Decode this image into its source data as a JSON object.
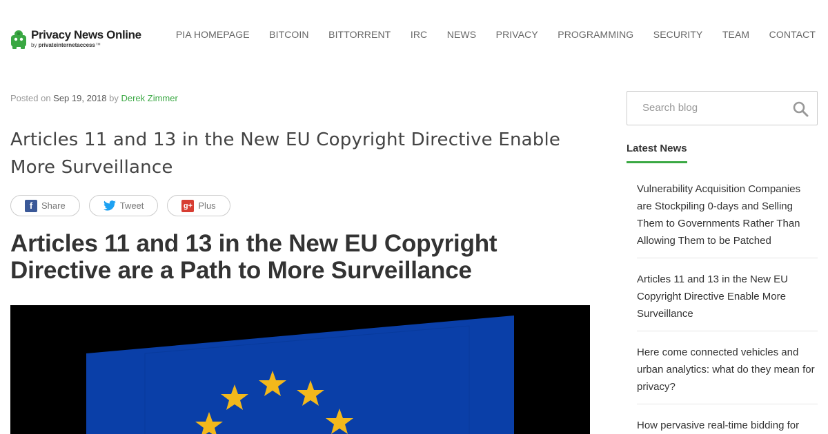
{
  "header": {
    "logo_title": "Privacy News Online",
    "logo_sub_prefix": "by ",
    "logo_sub_brand": "privateinternetaccess",
    "logo_sub_tm": "™",
    "nav": [
      "PIA HOMEPAGE",
      "BITCOIN",
      "BITTORRENT",
      "IRC",
      "NEWS",
      "PRIVACY",
      "PROGRAMMING",
      "SECURITY",
      "TEAM",
      "CONTACT"
    ]
  },
  "post": {
    "posted_on": "Posted on ",
    "date": "Sep 19, 2018",
    "by": " by ",
    "author": "Derek Zimmer",
    "title": "Articles 11 and 13 in the New EU Copyright Directive Enable More Surveillance",
    "heading": "Articles 11 and 13 in the New EU Copyright Directive are a Path to More Surveillance"
  },
  "share": {
    "facebook": "Share",
    "twitter": "Tweet",
    "googleplus": "Plus"
  },
  "sidebar": {
    "search_placeholder": "Search blog",
    "latest_heading": "Latest News",
    "latest_items": [
      "Vulnerability Acquisition Companies are Stockpiling 0-days and Selling Them to Governments Rather Than Allowing Them to be Patched",
      "Articles 11 and 13 in the New EU Copyright Directive Enable More Surveillance",
      "Here come connected vehicles and urban analytics: what do they mean for privacy?",
      "How pervasive real-time bidding for"
    ]
  },
  "colors": {
    "brand_green": "#3aa843",
    "eu_blue": "#0a3fa8",
    "eu_star": "#f3b81b"
  },
  "icons": {
    "logo": "robot-lock-logo-icon",
    "search": "search-icon",
    "facebook": "facebook-icon",
    "twitter": "twitter-icon",
    "googleplus": "google-plus-icon"
  }
}
